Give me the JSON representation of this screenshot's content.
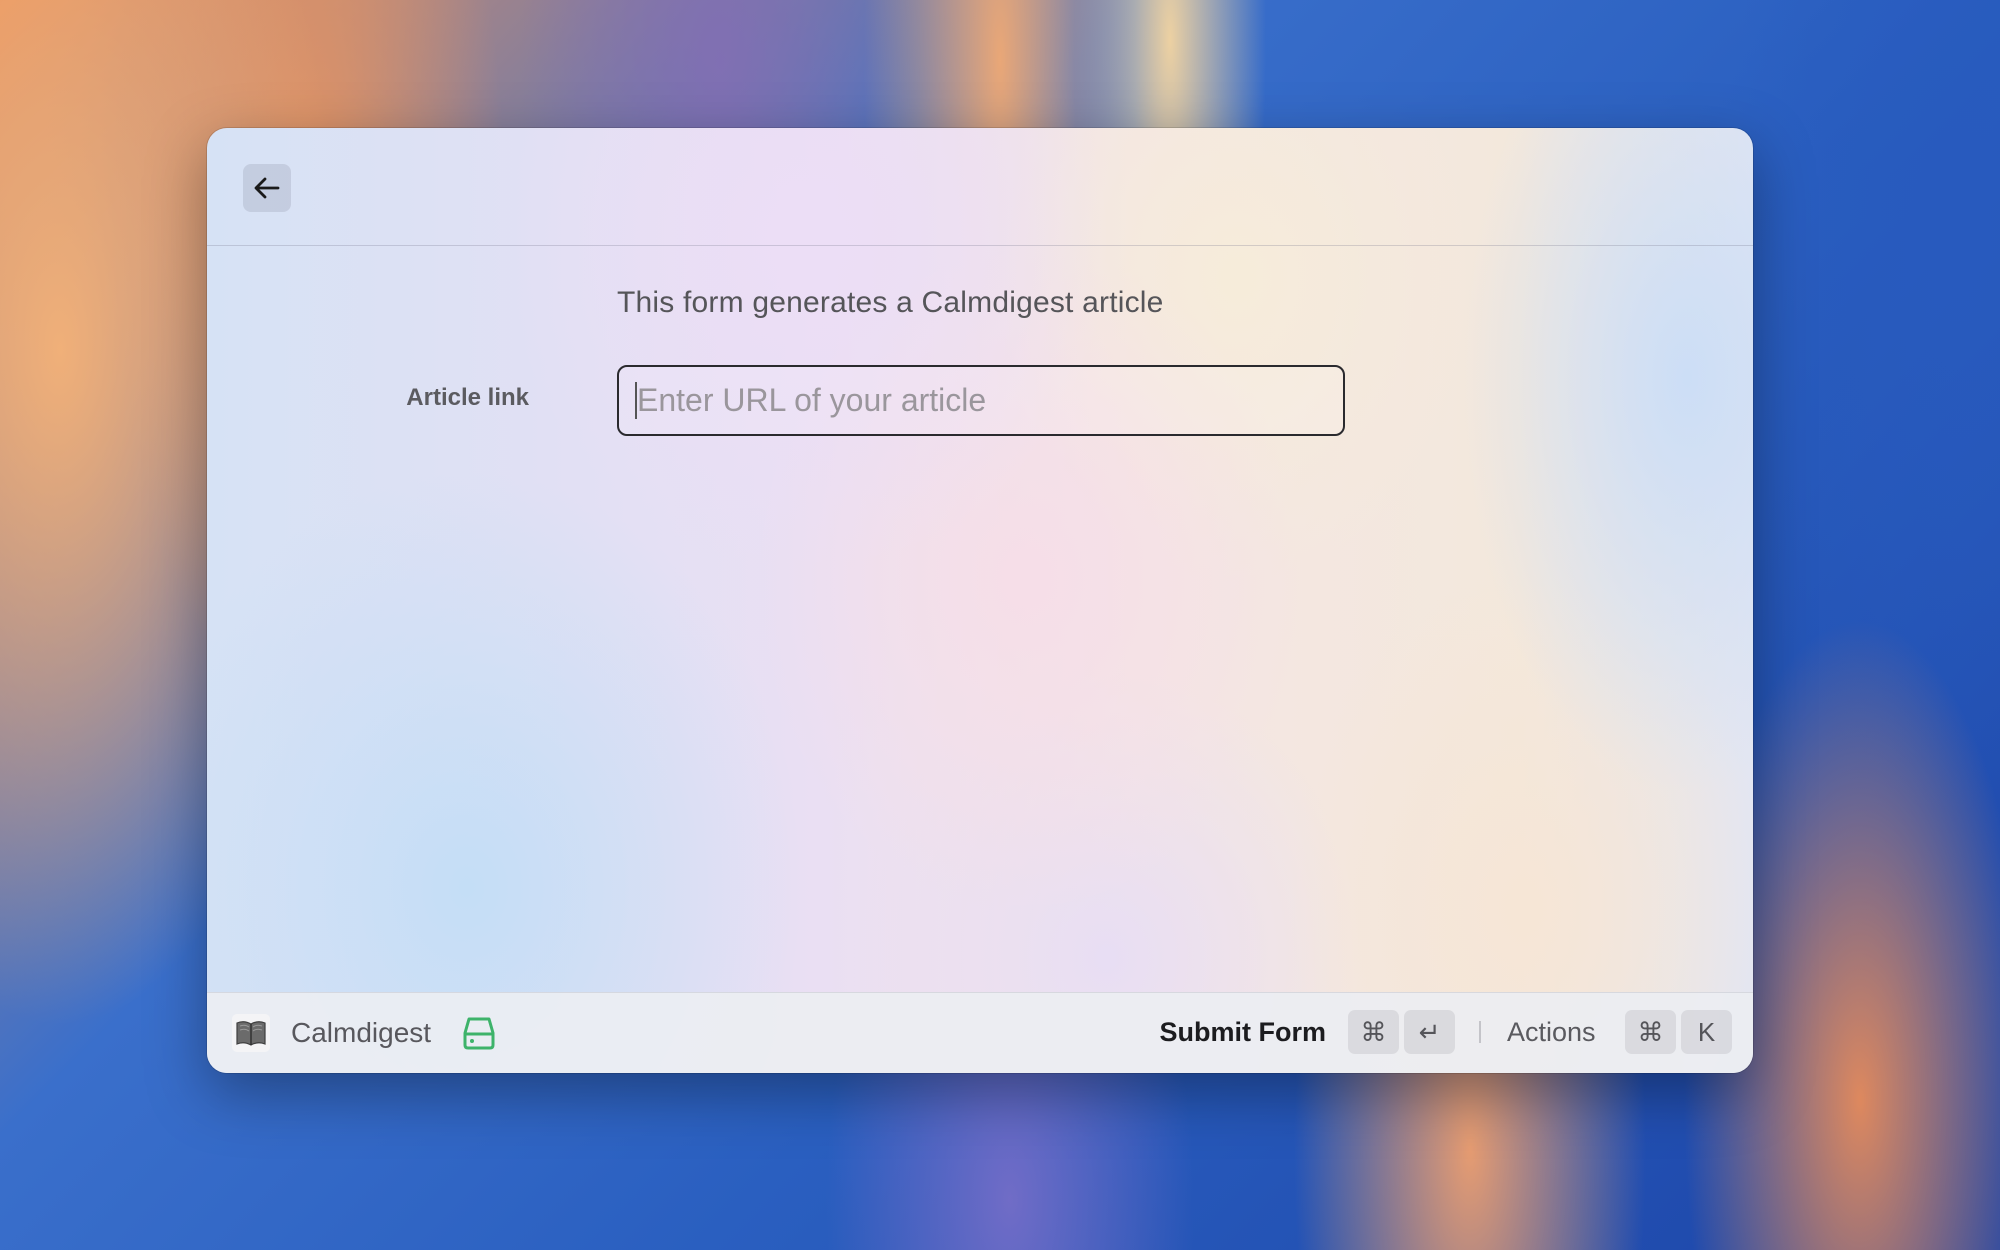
{
  "form": {
    "description": "This form generates a Calmdigest article",
    "field_label": "Article link",
    "input_value": "",
    "input_placeholder": "Enter URL of your article"
  },
  "footer": {
    "app_name": "Calmdigest",
    "app_icon": "open-book-icon",
    "storage_icon": "hard-drive-icon",
    "storage_icon_color": "#3db36a",
    "submit_label": "Submit Form",
    "submit_shortcut": [
      "⌘",
      "↵"
    ],
    "actions_label": "Actions",
    "actions_shortcut": [
      "⌘",
      "K"
    ]
  },
  "header": {
    "back_icon": "arrow-left-icon"
  }
}
